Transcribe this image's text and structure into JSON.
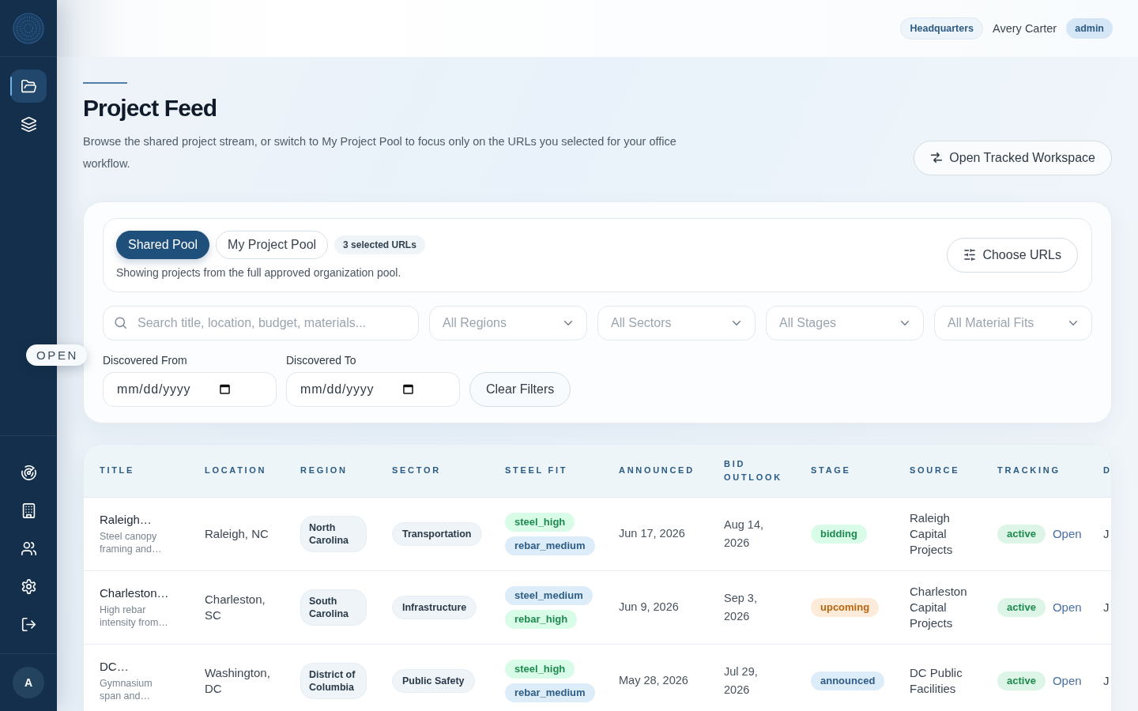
{
  "sidebar": {
    "nav_top": [
      {
        "selected": true
      },
      {
        "selected": false
      }
    ],
    "nav_bottom": [
      {
        "selected": false
      },
      {
        "selected": false
      },
      {
        "selected": false
      },
      {
        "selected": false
      },
      {
        "selected": false
      }
    ],
    "avatar_initial": "A",
    "panel_toggle": "OPEN"
  },
  "top_bar": {
    "office_badge": "Headquarters",
    "user_name": "Avery Carter",
    "role_badge": "admin"
  },
  "header": {
    "title": "Project Feed",
    "description": "Browse the shared project stream, or switch to My Project Pool to focus only on the URLs you selected for your office workflow.",
    "action_button": "Open Tracked Workspace"
  },
  "filters": {
    "pool_tabs": [
      {
        "label": "Shared Pool",
        "selected": true
      },
      {
        "label": "My Project Pool",
        "selected": false
      }
    ],
    "selection_badge": "3 selected URLs",
    "pool_note": "Showing projects from the full approved organization pool.",
    "choose_button": "Choose URLs",
    "search": {
      "placeholder": "Search title, location, budget, materials..."
    },
    "selects": [
      "All Regions",
      "All Sectors",
      "All Stages",
      "All Material Fits"
    ],
    "date_fields": [
      {
        "label": "Discovered From",
        "placeholder": "mm/dd/yyyy"
      },
      {
        "label": "Discovered To",
        "placeholder": "mm/dd/yyyy"
      }
    ],
    "clear_button": "Clear Filters"
  },
  "table": {
    "columns": [
      "TITLE",
      "LOCATION",
      "REGION",
      "SECTOR",
      "STEEL FIT",
      "ANNOUNCED",
      "BID OUTLOOK",
      "STAGE",
      "SOURCE",
      "TRACKING",
      "D"
    ],
    "rows": [
      {
        "title": "Raleigh…",
        "summary": "Steel canopy framing and…",
        "location": "Raleigh, NC",
        "region": "North Carolina",
        "sector": "Transportation",
        "steel_fit": [
          {
            "label": "steel_high",
            "color": "#1e8a4f"
          },
          {
            "label": "rebar_medium",
            "color": "#2f5d86"
          }
        ],
        "announced": "Jun 17, 2026",
        "bid_outlook": "Aug 14, 2026",
        "stage": {
          "label": "bidding",
          "color": "#1e8a4f"
        },
        "source": "Raleigh Capital Projects",
        "tracking": "active",
        "link": "Open",
        "column_11": "J"
      },
      {
        "title": "Charleston…",
        "summary": "High rebar intensity from…",
        "location": "Charleston, SC",
        "region": "South Carolina",
        "sector": "Infrastructure",
        "steel_fit": [
          {
            "label": "steel_medium",
            "color": "#2f5d86"
          },
          {
            "label": "rebar_high",
            "color": "#1e8a4f"
          }
        ],
        "announced": "Jun 9, 2026",
        "bid_outlook": "Sep 3, 2026",
        "stage": {
          "label": "upcoming",
          "color": "#b8660f"
        },
        "source": "Charleston Capital Projects",
        "tracking": "active",
        "link": "Open",
        "column_11": "J"
      },
      {
        "title": "DC…",
        "summary": "Gymnasium span and…",
        "location": "Washington, DC",
        "region": "District of Columbia",
        "sector": "Public Safety",
        "steel_fit": [
          {
            "label": "steel_high",
            "color": "#1e8a4f"
          },
          {
            "label": "rebar_medium",
            "color": "#2f5d86"
          }
        ],
        "announced": "May 28, 2026",
        "bid_outlook": "Jul 29, 2026",
        "stage": {
          "label": "announced",
          "color": "#2f5d86"
        },
        "source": "DC Public Facilities",
        "tracking": "active",
        "link": "Open",
        "column_11": "J"
      }
    ]
  }
}
